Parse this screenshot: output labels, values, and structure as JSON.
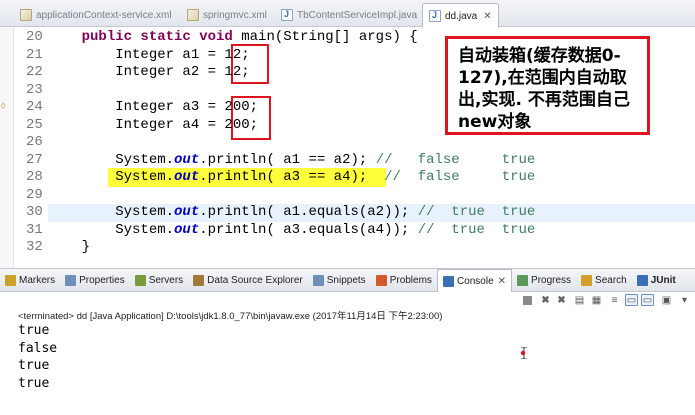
{
  "editor_tabs": [
    {
      "label": "applicationContext-service.xml",
      "icon": "xml-file-icon",
      "active": false
    },
    {
      "label": "springmvc.xml",
      "icon": "xml-file-icon",
      "active": false
    },
    {
      "label": "TbContentServiceImpl.java",
      "icon": "java-file-icon",
      "active": false
    },
    {
      "label": "dd.java",
      "icon": "java-file-icon",
      "active": true
    }
  ],
  "tab_close_glyph": "✕",
  "code": {
    "lines": [
      {
        "num": "20",
        "tokens": [
          {
            "t": "    "
          },
          {
            "t": "public static void",
            "c": "kw"
          },
          {
            "t": " main(String[] args) {"
          }
        ]
      },
      {
        "num": "21",
        "tokens": [
          {
            "t": "        Integer a1 = 12;"
          }
        ]
      },
      {
        "num": "22",
        "tokens": [
          {
            "t": "        Integer a2 = 12;"
          }
        ]
      },
      {
        "num": "23",
        "tokens": [
          {
            "t": ""
          }
        ]
      },
      {
        "num": "24",
        "tokens": [
          {
            "t": "        Integer a3 = 200;"
          }
        ]
      },
      {
        "num": "25",
        "tokens": [
          {
            "t": "        Integer a4 = 200;"
          }
        ]
      },
      {
        "num": "26",
        "tokens": [
          {
            "t": ""
          }
        ]
      },
      {
        "num": "27",
        "tokens": [
          {
            "t": "        System."
          },
          {
            "t": "out",
            "c": "fld"
          },
          {
            "t": ".println( a1 == a2); "
          },
          {
            "t": "//   false     true",
            "c": "cm"
          }
        ]
      },
      {
        "num": "28",
        "tokens": [
          {
            "t": "        System."
          },
          {
            "t": "out",
            "c": "fld"
          },
          {
            "t": ".println( a3 == a4);  "
          },
          {
            "t": "//  false     true",
            "c": "cm"
          }
        ]
      },
      {
        "num": "29",
        "tokens": [
          {
            "t": ""
          }
        ]
      },
      {
        "num": "30",
        "tokens": [
          {
            "t": "        System."
          },
          {
            "t": "out",
            "c": "fld"
          },
          {
            "t": ".println( a1.equals(a2)); "
          },
          {
            "t": "//  true  true",
            "c": "cm"
          }
        ]
      },
      {
        "num": "31",
        "tokens": [
          {
            "t": "        System."
          },
          {
            "t": "out",
            "c": "fld"
          },
          {
            "t": ".println( a3.equals(a4)); "
          },
          {
            "t": "//  true  true",
            "c": "cm"
          }
        ]
      },
      {
        "num": "32",
        "tokens": [
          {
            "t": "    }"
          }
        ]
      }
    ],
    "current_line_index": 10,
    "yellow_highlight_line_index": 8
  },
  "callout": {
    "text": "自动装箱(缓存数据0-127),在范围内自动取出,实现. 不再范围自己new对象"
  },
  "view_tabs": [
    {
      "label": "Markers",
      "icon": "markers-icon",
      "color": "#c9a227"
    },
    {
      "label": "Properties",
      "icon": "properties-icon",
      "color": "#6f8fb8"
    },
    {
      "label": "Servers",
      "icon": "servers-icon",
      "color": "#7a9a3b"
    },
    {
      "label": "Data Source Explorer",
      "icon": "data-source-icon",
      "color": "#a07a3a"
    },
    {
      "label": "Snippets",
      "icon": "snippets-icon",
      "color": "#6f8fb8"
    },
    {
      "label": "Problems",
      "icon": "problems-icon",
      "color": "#d45a2a"
    },
    {
      "label": "Console",
      "icon": "console-icon",
      "color": "#3a6fb4",
      "active": true
    },
    {
      "label": "Progress",
      "icon": "progress-icon",
      "color": "#5a9a5a"
    },
    {
      "label": "Search",
      "icon": "search-icon",
      "color": "#d4a02a"
    },
    {
      "label": "JUnit",
      "icon": "junit-icon",
      "color": "#3a6fb4",
      "bold": true
    }
  ],
  "console": {
    "terminated_label": "<terminated> dd [Java Application] D:\\tools\\jdk1.8.0_77\\bin\\javaw.exe (2017年11月14日 下午2:23:00)",
    "output": [
      "true",
      "false",
      "true",
      "true"
    ]
  },
  "colors": {
    "keyword": "#7f0055",
    "field": "#0000c0",
    "comment": "#3f7f5f",
    "annotation_red": "#e0141e",
    "highlight_yellow": "#ffff3c"
  }
}
